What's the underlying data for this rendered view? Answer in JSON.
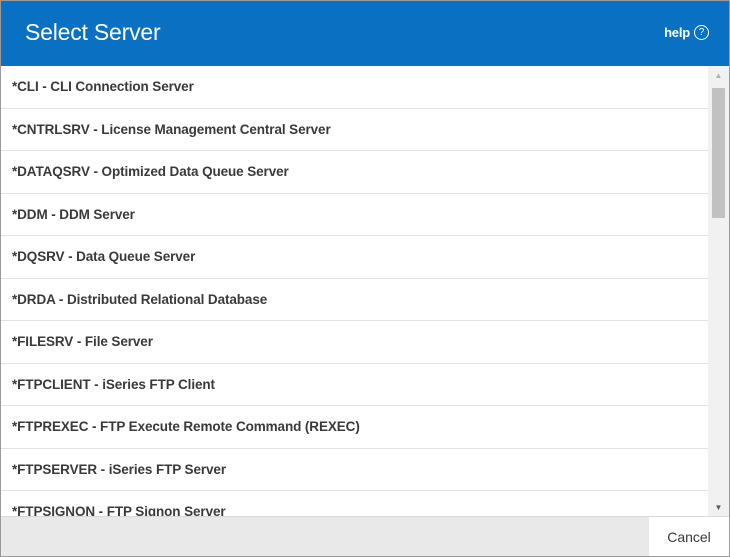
{
  "dialog": {
    "title": "Select Server",
    "help_label": "help",
    "help_icon": "?",
    "accent_color": "#0a70c2"
  },
  "servers": [
    "*CLI - CLI Connection Server",
    "*CNTRLSRV - License Management Central Server",
    "*DATAQSRV - Optimized Data Queue Server",
    "*DDM - DDM Server",
    "*DQSRV - Data Queue Server",
    "*DRDA - Distributed Relational Database",
    "*FILESRV - File Server",
    "*FTPCLIENT - iSeries FTP Client",
    "*FTPREXEC - FTP Execute Remote Command (REXEC)",
    "*FTPSERVER - iSeries FTP Server",
    "*FTPSIGNON - FTP Signon Server"
  ],
  "scrollbar": {
    "up_icon": "▲",
    "down_icon": "▼"
  },
  "footer": {
    "cancel_label": "Cancel"
  }
}
